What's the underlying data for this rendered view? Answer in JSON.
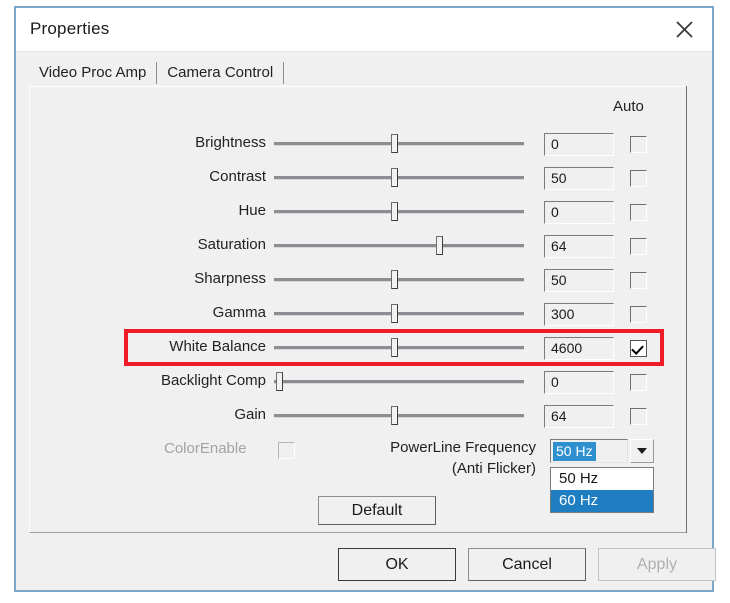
{
  "window": {
    "title": "Properties",
    "close_icon": "close-icon"
  },
  "tabs": [
    {
      "label": "Video Proc Amp",
      "active": true
    },
    {
      "label": "Camera Control",
      "active": false
    }
  ],
  "panel": {
    "auto_column_header": "Auto",
    "controls": [
      {
        "label": "Brightness",
        "value": "0",
        "thumb_pct": 48,
        "auto": false
      },
      {
        "label": "Contrast",
        "value": "50",
        "thumb_pct": 48,
        "auto": false
      },
      {
        "label": "Hue",
        "value": "0",
        "thumb_pct": 48,
        "auto": false
      },
      {
        "label": "Saturation",
        "value": "64",
        "thumb_pct": 66,
        "auto": false
      },
      {
        "label": "Sharpness",
        "value": "50",
        "thumb_pct": 48,
        "auto": false
      },
      {
        "label": "Gamma",
        "value": "300",
        "thumb_pct": 48,
        "auto": false
      },
      {
        "label": "White Balance",
        "value": "4600",
        "thumb_pct": 48,
        "auto": true,
        "highlighted": true
      },
      {
        "label": "Backlight Comp",
        "value": "0",
        "thumb_pct": 2,
        "auto": false
      },
      {
        "label": "Gain",
        "value": "64",
        "thumb_pct": 48,
        "auto": false
      }
    ],
    "color_enable": {
      "label": "ColorEnable",
      "checked": false,
      "disabled": true
    },
    "powerline": {
      "label_line1": "PowerLine Frequency",
      "label_line2": "(Anti Flicker)",
      "selected": "50 Hz",
      "options": [
        {
          "label": "50 Hz",
          "selected": false
        },
        {
          "label": "60 Hz",
          "selected": true
        }
      ],
      "arrow_icon": "chevron-down-icon"
    },
    "default_button": "Default"
  },
  "footer": {
    "ok": "OK",
    "cancel": "Cancel",
    "apply": "Apply"
  },
  "colors": {
    "highlight_red": "#ee1c25",
    "selection_blue": "#1f7ec2",
    "window_border": "#7ba7c7",
    "dialog_bg": "#f0f0f0"
  }
}
